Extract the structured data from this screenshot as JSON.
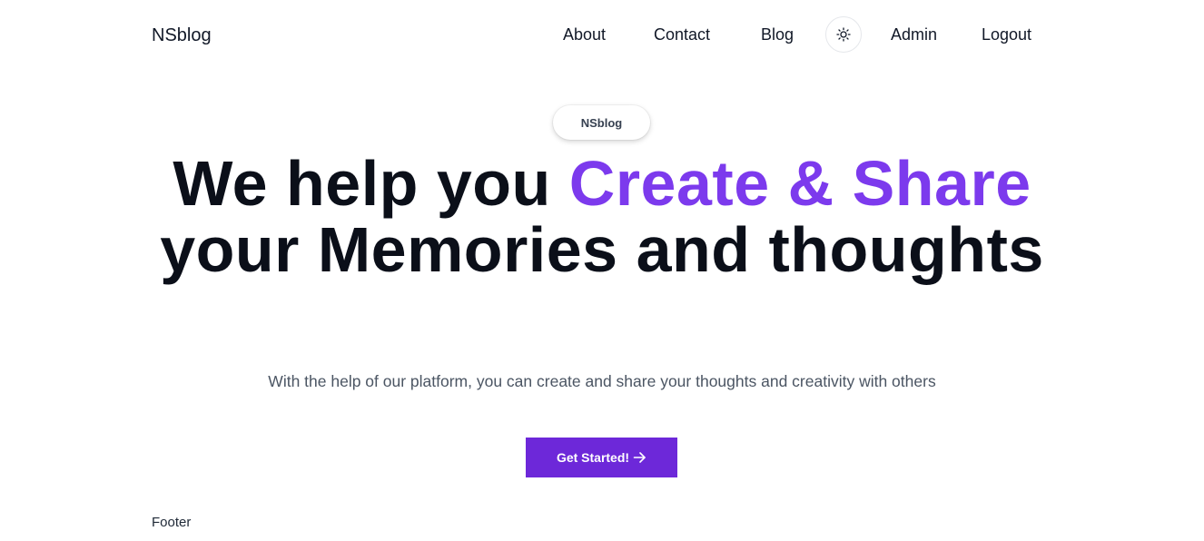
{
  "nav": {
    "brand": "NSblog",
    "links": [
      "About",
      "Contact",
      "Blog"
    ],
    "theme_toggle_icon": "sun-icon",
    "admin": "Admin",
    "logout": "Logout"
  },
  "hero": {
    "badge": "NSblog",
    "title_part1": "We help you ",
    "title_accent": "Create & Share",
    "title_part2": " your Memories and thoughts",
    "subtitle": "With the help of our platform, you can create and share your thoughts and creativity with others",
    "cta_label": "Get Started!",
    "cta_icon": "arrow-right-icon"
  },
  "footer": {
    "text": "Footer"
  },
  "colors": {
    "accent": "#7c3aed",
    "button": "#6d28d9",
    "text": "#0b0f19"
  }
}
